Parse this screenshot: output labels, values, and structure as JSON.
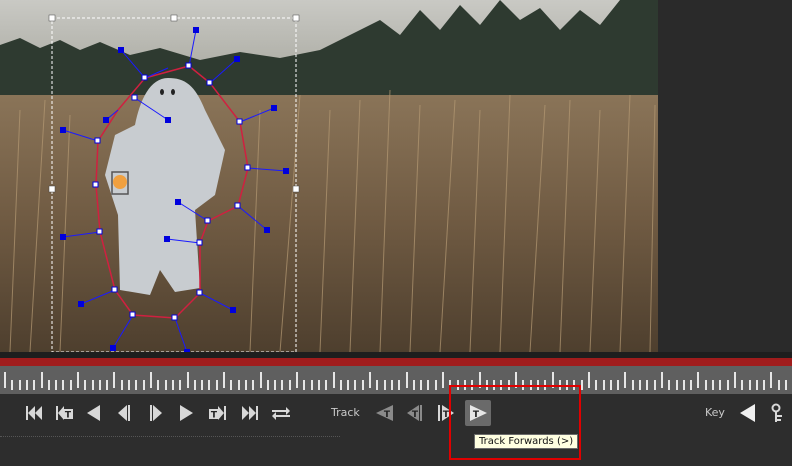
{
  "toolbar": {
    "track_label": "Track",
    "key_label": "Key",
    "tooltip": "Track Forwards (>)"
  },
  "colors": {
    "timeline_red": "#a01c1c",
    "highlight": "#e00000",
    "mask_outline": "#d02040",
    "tracker_points": "#0000dd",
    "tooltip_bg": "#ffffe1"
  },
  "icons": {
    "transport": [
      "skip-to-start-icon",
      "previous-keyframe-icon",
      "play-backward-icon",
      "step-backward-icon",
      "step-forward-icon",
      "play-forward-icon",
      "next-keyframe-icon",
      "skip-to-end-icon",
      "loop-icon"
    ],
    "track": [
      "track-backward-icon",
      "track-one-frame-backward-icon",
      "track-one-frame-forward-icon",
      "track-forwards-icon"
    ],
    "key": [
      "add-keyframe-icon",
      "key-settings-icon"
    ]
  }
}
